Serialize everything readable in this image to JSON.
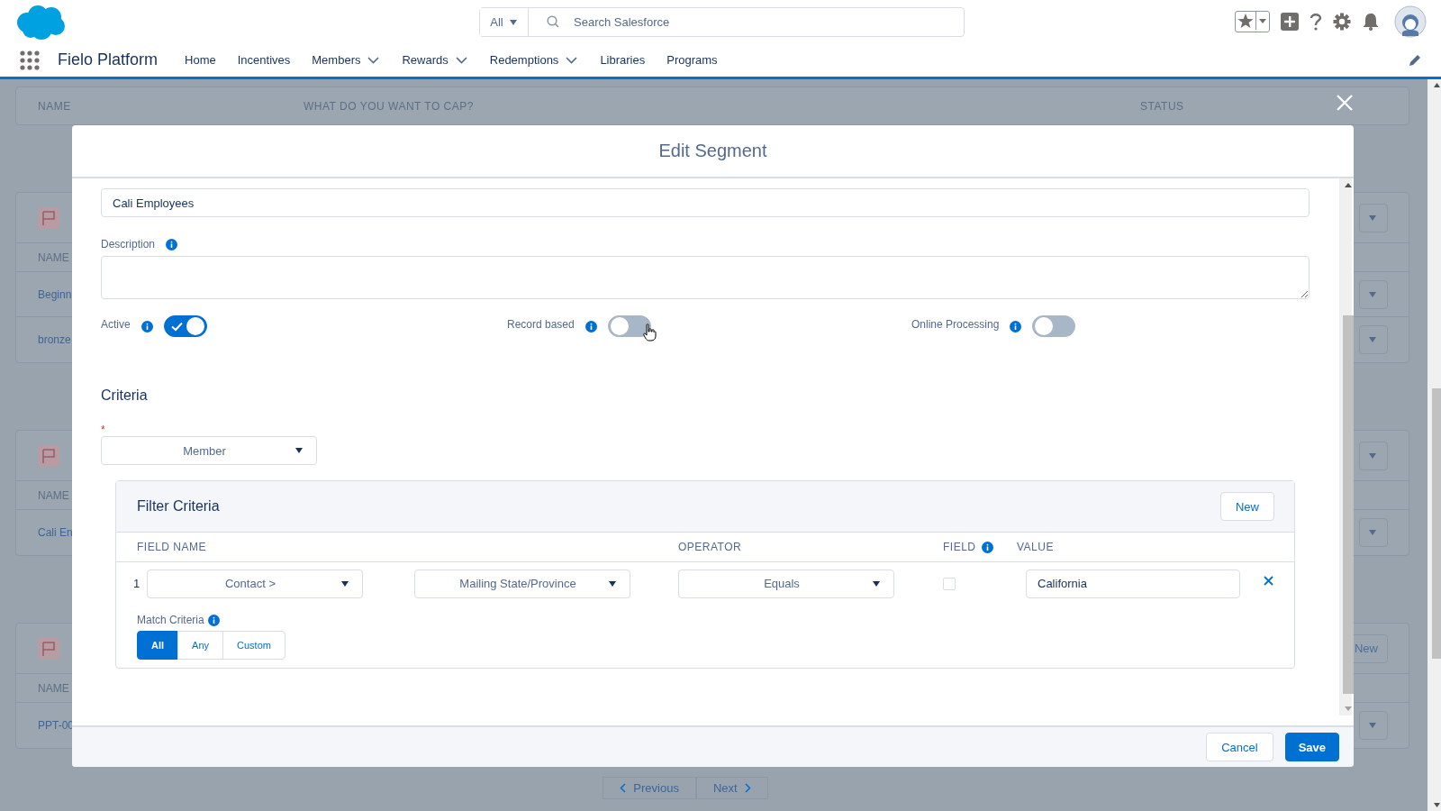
{
  "header": {
    "search": {
      "scope": "All",
      "placeholder": "Search Salesforce"
    }
  },
  "nav": {
    "app_name": "Fielo Platform",
    "items": [
      {
        "label": "Home",
        "has_menu": false
      },
      {
        "label": "Incentives",
        "has_menu": false
      },
      {
        "label": "Members",
        "has_menu": true
      },
      {
        "label": "Rewards",
        "has_menu": true
      },
      {
        "label": "Redemptions",
        "has_menu": true
      },
      {
        "label": "Libraries",
        "has_menu": false
      },
      {
        "label": "Programs",
        "has_menu": false
      }
    ]
  },
  "background": {
    "table_header": [
      "NAME",
      "WHAT DO YOU WANT TO CAP?",
      "STATUS"
    ],
    "cards": [
      {
        "column": "NAME",
        "rows": [
          "Beginn",
          "bronze"
        ]
      },
      {
        "column": "NAME",
        "rows": [
          "Cali En"
        ]
      },
      {
        "column": "NAME",
        "rows": [
          "PPT-00"
        ],
        "button": "New"
      }
    ],
    "pagination": [
      "Previous",
      "Next"
    ]
  },
  "modal": {
    "title": "Edit Segment",
    "name_value": "Cali Employees",
    "description": {
      "label": "Description"
    },
    "toggles": [
      {
        "label": "Active",
        "on": true
      },
      {
        "label": "Record based",
        "on": false
      },
      {
        "label": "Online Processing",
        "on": false
      }
    ],
    "criteria": {
      "title": "Criteria",
      "required_mark": "*",
      "object": "Member"
    },
    "filter": {
      "title": "Filter Criteria",
      "new_button": "New",
      "columns": [
        "FIELD NAME",
        "OPERATOR",
        "FIELD",
        "VALUE"
      ],
      "rows": [
        {
          "number": "1",
          "field": "Contact >",
          "subfield": "Mailing State/Province",
          "operator": "Equals",
          "is_field": false,
          "value": "California"
        }
      ],
      "match_label": "Match Criteria",
      "match_options": [
        {
          "label": "All",
          "selected": true
        },
        {
          "label": "Any",
          "selected": false
        },
        {
          "label": "Custom",
          "selected": false
        }
      ]
    },
    "buttons": {
      "cancel": "Cancel",
      "save": "Save"
    }
  }
}
